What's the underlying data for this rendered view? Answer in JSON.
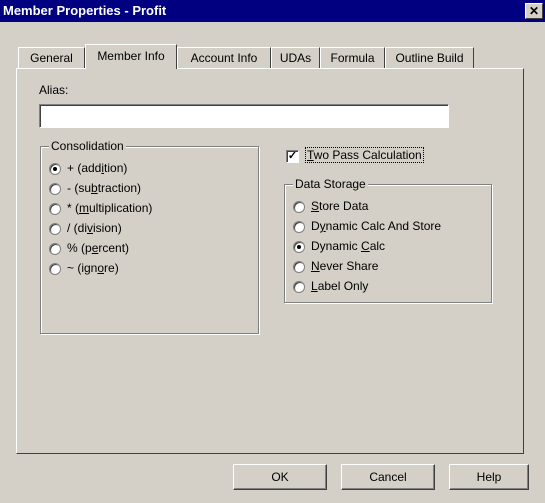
{
  "window": {
    "title": "Member Properties - Profit",
    "close_glyph": "✕"
  },
  "tabs": [
    {
      "label": "General",
      "active": false
    },
    {
      "label": "Member Info",
      "active": true
    },
    {
      "label": "Account Info",
      "active": false
    },
    {
      "label": "UDAs",
      "active": false
    },
    {
      "label": "Formula",
      "active": false
    },
    {
      "label": "Outline Build",
      "active": false
    }
  ],
  "alias": {
    "label": "Alias:",
    "value": ""
  },
  "consolidation": {
    "title": "Consolidation",
    "options": [
      {
        "pre": "+ (add",
        "u": "i",
        "post": "tion)",
        "checked": true
      },
      {
        "pre": "- (su",
        "u": "b",
        "post": "traction)",
        "checked": false
      },
      {
        "pre": "* (",
        "u": "m",
        "post": "ultiplication)",
        "checked": false
      },
      {
        "pre": "/ (di",
        "u": "v",
        "post": "ision)",
        "checked": false
      },
      {
        "pre": "% (p",
        "u": "e",
        "post": "rcent)",
        "checked": false
      },
      {
        "pre": "~ (ign",
        "u": "o",
        "post": "re)",
        "checked": false
      }
    ]
  },
  "two_pass": {
    "u": "T",
    "post": "wo Pass Calculation",
    "checked": true,
    "check_glyph": "✓"
  },
  "data_storage": {
    "title": "Data Storage",
    "options": [
      {
        "pre": "",
        "u": "S",
        "post": "tore Data",
        "checked": false
      },
      {
        "pre": "D",
        "u": "y",
        "post": "namic Calc And Store",
        "checked": false
      },
      {
        "pre": "Dynamic ",
        "u": "C",
        "post": "alc",
        "checked": true
      },
      {
        "pre": "",
        "u": "N",
        "post": "ever Share",
        "checked": false
      },
      {
        "pre": "",
        "u": "L",
        "post": "abel Only",
        "checked": false
      }
    ]
  },
  "buttons": {
    "ok": "OK",
    "cancel": "Cancel",
    "help": "Help"
  }
}
